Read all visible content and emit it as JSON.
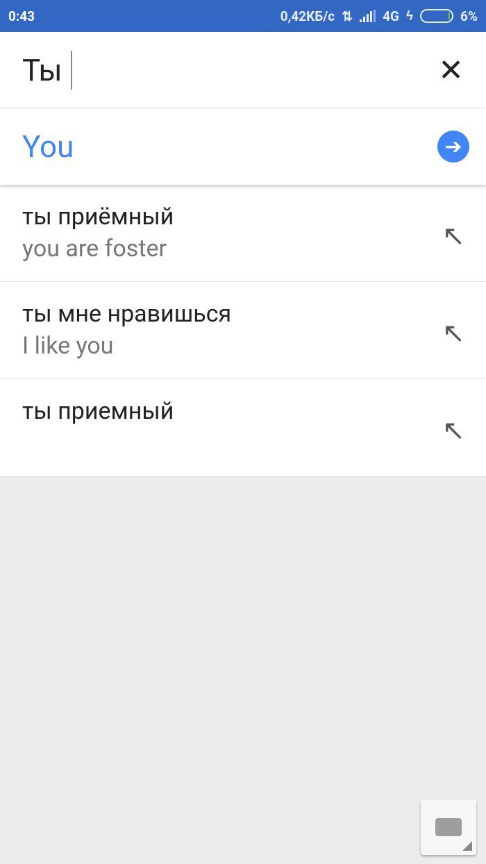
{
  "status_bar": {
    "time": "0:43",
    "net_speed": "0,42КБ/с",
    "network": "4G",
    "battery": "6%",
    "battery_level": 0.06
  },
  "search": {
    "input_value": "Ты"
  },
  "translation": {
    "text": "You"
  },
  "suggestions": [
    {
      "source": "ты приёмный",
      "translation": "you are foster"
    },
    {
      "source": "ты мне нравишься",
      "translation": "I like you"
    },
    {
      "source": "ты приемный",
      "translation": ""
    }
  ]
}
